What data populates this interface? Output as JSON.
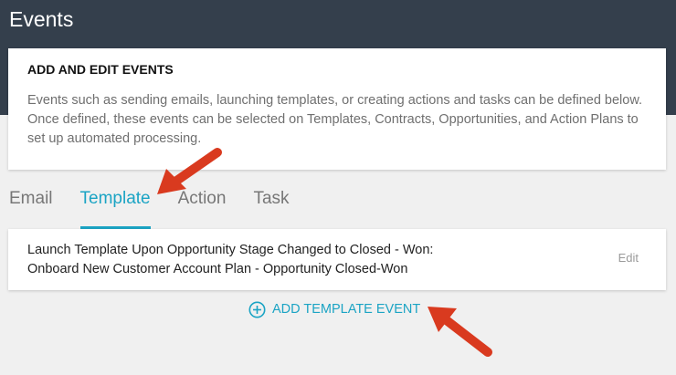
{
  "header": {
    "title": "Events"
  },
  "info": {
    "heading": "ADD AND EDIT EVENTS",
    "description": "Events such as sending emails, launching templates, or creating actions and tasks can be defined below. Once defined, these events can be selected on Templates, Contracts, Opportunities, and Action Plans to set up automated processing."
  },
  "tabs": [
    {
      "label": "Email"
    },
    {
      "label": "Template",
      "active": true
    },
    {
      "label": "Action"
    },
    {
      "label": "Task"
    }
  ],
  "events": [
    {
      "line1": "Launch Template Upon Opportunity Stage Changed to Closed - Won:",
      "line2": "Onboard New Customer Account Plan - Opportunity Closed-Won",
      "edit_label": "Edit"
    }
  ],
  "add_button": {
    "label": "ADD TEMPLATE EVENT",
    "icon": "plus-circle-icon"
  },
  "colors": {
    "header_bg": "#343f4c",
    "accent": "#1ba4c4",
    "annotation_arrow": "#d93a1f"
  }
}
